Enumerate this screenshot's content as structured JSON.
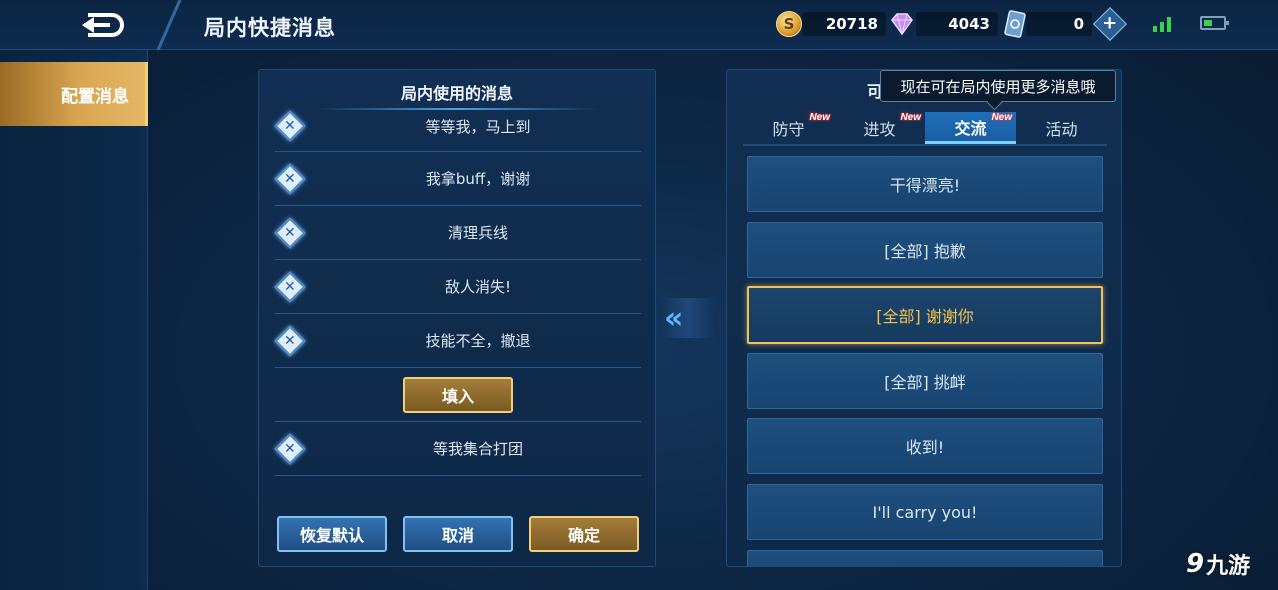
{
  "header": {
    "title": "局内快捷消息",
    "gold": "20718",
    "diamonds": "4043",
    "tickets": "0",
    "coin_symbol": "S",
    "plus_symbol": "+"
  },
  "sidebar": {
    "items": [
      {
        "label": "配置消息",
        "active": true
      }
    ]
  },
  "left_panel": {
    "title": "局内使用的消息",
    "messages": [
      "等等我，马上到",
      "我拿buff，谢谢",
      "清理兵线",
      "敌人消失!",
      "技能不全，撤退"
    ],
    "fill_label": "填入",
    "extra_message": "等我集合打团",
    "remove_symbol": "✕",
    "buttons": {
      "reset": "恢复默认",
      "cancel": "取消",
      "confirm": "确定"
    }
  },
  "right_panel": {
    "title_fragment": "可",
    "tooltip": "现在可在局内使用更多消息哦",
    "tabs": [
      {
        "label": "防守",
        "badge": "New",
        "active": false
      },
      {
        "label": "进攻",
        "badge": "New",
        "active": false
      },
      {
        "label": "交流",
        "badge": "New",
        "active": true
      },
      {
        "label": "活动",
        "badge": "",
        "active": false
      }
    ],
    "options": [
      {
        "label": "干得漂亮!",
        "selected": false
      },
      {
        "label": "[全部] 抱歉",
        "selected": false
      },
      {
        "label": "[全部] 谢谢你",
        "selected": true
      },
      {
        "label": "[全部] 挑衅",
        "selected": false
      },
      {
        "label": "收到!",
        "selected": false
      },
      {
        "label": "I'll carry you!",
        "selected": false
      }
    ]
  },
  "transfer_arrow": "«",
  "watermark": {
    "mark": "9",
    "text": "九游"
  },
  "colors": {
    "accent_gold": "#f0c35a",
    "tab_active": "#1f6fb9",
    "new_badge": "#ff2c2c"
  }
}
